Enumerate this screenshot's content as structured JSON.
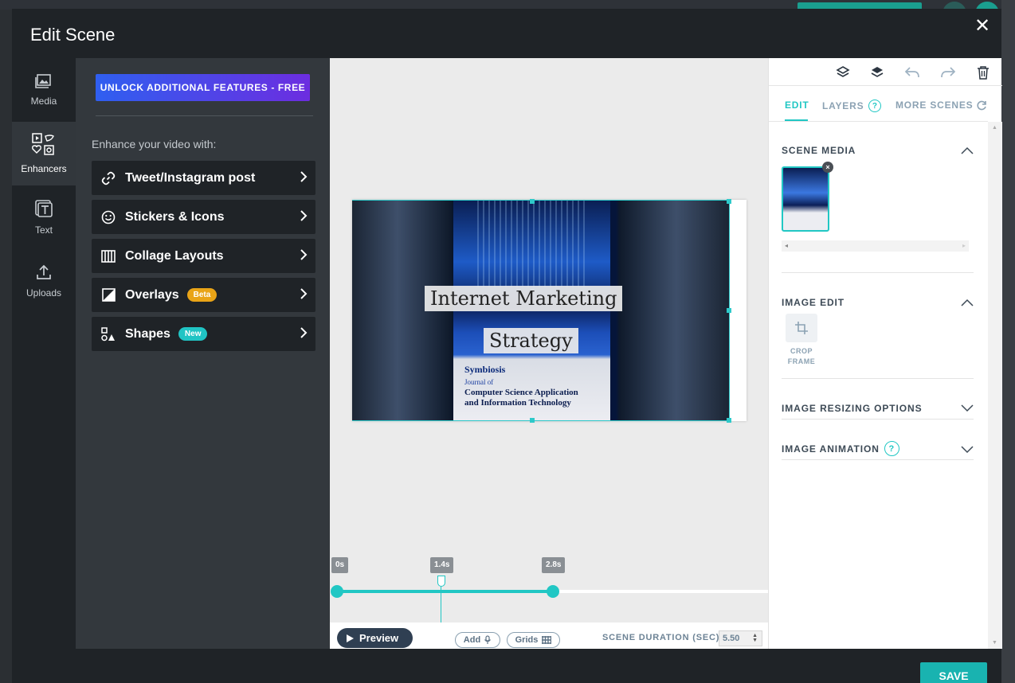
{
  "modal": {
    "title": "Edit Scene"
  },
  "rail": {
    "items": [
      {
        "label": "Media",
        "icon": "image-icon"
      },
      {
        "label": "Enhancers",
        "icon": "enhancers-icon",
        "active": true
      },
      {
        "label": "Text",
        "icon": "text-icon"
      },
      {
        "label": "Uploads",
        "icon": "upload-icon"
      }
    ]
  },
  "panel": {
    "unlock_label": "UNLOCK ADDITIONAL FEATURES - FREE",
    "subtitle": "Enhance your video with:",
    "items": [
      {
        "label": "Tweet/Instagram post",
        "icon": "link-icon"
      },
      {
        "label": "Stickers & Icons",
        "icon": "smiley-icon"
      },
      {
        "label": "Collage Layouts",
        "icon": "columns-icon"
      },
      {
        "label": "Overlays",
        "icon": "overlay-icon",
        "badge": "Beta"
      },
      {
        "label": "Shapes",
        "icon": "shapes-icon",
        "badge": "New"
      }
    ]
  },
  "canvas": {
    "title_line1": "Internet Marketing",
    "title_line2": "Strategy",
    "cover": {
      "logo": "Symbiosis",
      "journal": "Journal of",
      "line1": "Computer Science Application",
      "line2": "and  Information Technology"
    }
  },
  "timeline": {
    "start_label": "0s",
    "mid_label": "1.4s",
    "end_label": "2.8s",
    "preview_label": "Preview",
    "add_label": "Add",
    "grids_label": "Grids",
    "duration_label": "SCENE DURATION (SEC)",
    "duration_value": "5.50"
  },
  "right_panel": {
    "tabs": {
      "edit": "EDIT",
      "layers": "LAYERS",
      "more_scenes": "MORE SCENES"
    },
    "scene_media_title": "SCENE MEDIA",
    "image_edit_title": "IMAGE EDIT",
    "crop_label_1": "CROP",
    "crop_label_2": "FRAME",
    "resizing_title": "IMAGE RESIZING OPTIONS",
    "animation_title": "IMAGE ANIMATION"
  },
  "save_label": "SAVE",
  "colors": {
    "accent": "#21c7c4",
    "dark": "#1f2327",
    "panel": "#33383d"
  }
}
